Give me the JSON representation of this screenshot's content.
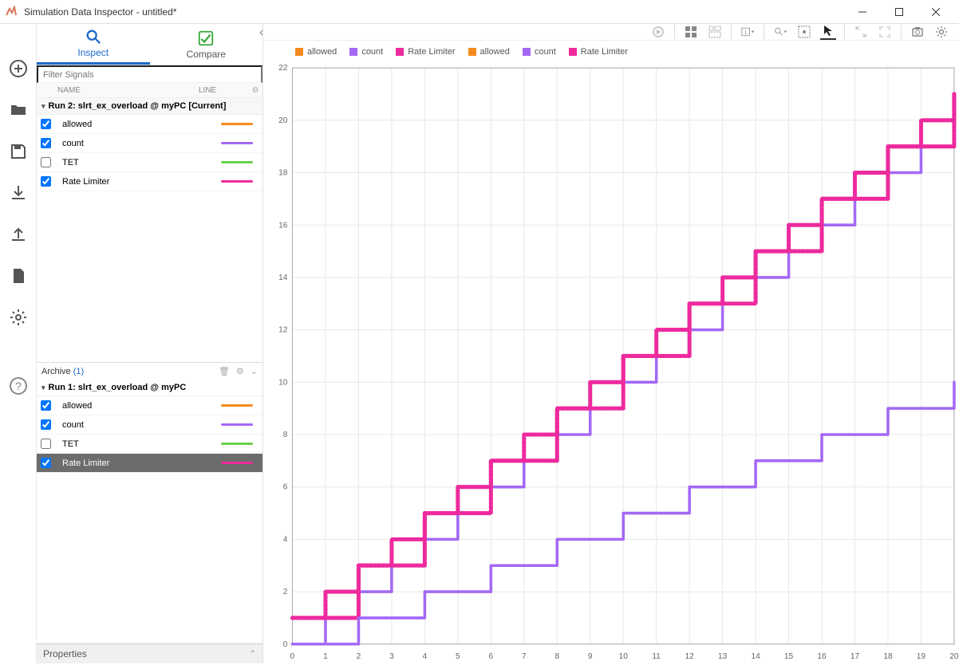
{
  "window": {
    "title": "Simulation Data Inspector - untitled*"
  },
  "tabs": {
    "inspect": "Inspect",
    "compare": "Compare"
  },
  "filter_placeholder": "Filter Signals",
  "columns": {
    "name": "NAME",
    "line": "LINE"
  },
  "run2": {
    "title": "Run 2: slrt_ex_overload @ myPC [Current]",
    "signals": [
      {
        "name": "allowed",
        "checked": true,
        "color": "#f58a1f"
      },
      {
        "name": "count",
        "checked": true,
        "color": "#a468f5"
      },
      {
        "name": "TET",
        "checked": false,
        "color": "#6bd34b"
      },
      {
        "name": "Rate Limiter",
        "checked": true,
        "color": "#ed2a9d"
      }
    ]
  },
  "archive": {
    "label": "Archive",
    "count": "(1)"
  },
  "run1": {
    "title": "Run 1: slrt_ex_overload @ myPC",
    "signals": [
      {
        "name": "allowed",
        "checked": true,
        "color": "#f58a1f"
      },
      {
        "name": "count",
        "checked": true,
        "color": "#a468f5"
      },
      {
        "name": "TET",
        "checked": false,
        "color": "#6bd34b"
      },
      {
        "name": "Rate Limiter",
        "checked": true,
        "color": "#ed2a9d",
        "selected": true
      }
    ]
  },
  "properties_label": "Properties",
  "legend": [
    {
      "label": "allowed",
      "color": "#f58a1f"
    },
    {
      "label": "count",
      "color": "#a468f5"
    },
    {
      "label": "Rate Limiter",
      "color": "#ed2a9d"
    },
    {
      "label": "allowed",
      "color": "#f58a1f"
    },
    {
      "label": "count",
      "color": "#a468f5"
    },
    {
      "label": "Rate Limiter",
      "color": "#ed2a9d"
    }
  ],
  "chart_data": {
    "type": "line",
    "xlim": [
      0,
      20
    ],
    "ylim": [
      0,
      22
    ],
    "xticks": [
      0,
      1,
      2,
      3,
      4,
      5,
      6,
      7,
      8,
      9,
      10,
      11,
      12,
      13,
      14,
      15,
      16,
      17,
      18,
      19,
      20
    ],
    "yticks": [
      0,
      2,
      4,
      6,
      8,
      10,
      12,
      14,
      16,
      18,
      20,
      22
    ],
    "series": [
      {
        "name": "Run2 allowed",
        "color": "#f58a1f",
        "style": "step",
        "x": [
          0,
          1,
          1,
          2,
          2,
          3,
          3,
          4,
          4,
          5,
          5,
          6,
          6,
          7,
          7,
          8,
          8,
          9,
          9,
          10,
          10,
          11,
          11,
          12,
          12,
          13,
          13,
          14,
          14,
          15,
          15,
          16,
          16,
          17,
          17,
          18,
          18,
          19,
          19,
          20,
          20
        ],
        "y": [
          1,
          1,
          2,
          2,
          3,
          3,
          4,
          4,
          5,
          5,
          6,
          6,
          7,
          7,
          8,
          8,
          9,
          9,
          10,
          10,
          11,
          11,
          12,
          12,
          13,
          13,
          14,
          14,
          15,
          15,
          16,
          16,
          17,
          17,
          18,
          18,
          19,
          19,
          20,
          20,
          21
        ]
      },
      {
        "name": "Run2 Rate Limiter",
        "color": "#ed2a9d",
        "style": "step-hash",
        "x": [
          0,
          1,
          1,
          2,
          2,
          3,
          3,
          4,
          4,
          5,
          5,
          6,
          6,
          7,
          7,
          8,
          8,
          9,
          9,
          10,
          10,
          11,
          11,
          12,
          12,
          13,
          13,
          14,
          14,
          15,
          15,
          16,
          16,
          17,
          17,
          18,
          18,
          19,
          19,
          20,
          20
        ],
        "y": [
          1,
          1,
          2,
          2,
          3,
          3,
          4,
          4,
          5,
          5,
          6,
          6,
          7,
          7,
          8,
          8,
          9,
          9,
          10,
          10,
          11,
          11,
          12,
          12,
          13,
          13,
          14,
          14,
          15,
          15,
          16,
          16,
          17,
          17,
          18,
          18,
          19,
          19,
          20,
          20,
          21
        ]
      },
      {
        "name": "Run2 count",
        "color": "#a468f5",
        "style": "step",
        "x": [
          0,
          1,
          1,
          2,
          2,
          3,
          3,
          4,
          4,
          5,
          5,
          6,
          6,
          7,
          7,
          8,
          8,
          9,
          9,
          10,
          10,
          11,
          11,
          12,
          12,
          13,
          13,
          14,
          14,
          15,
          15,
          16,
          16,
          17,
          17,
          18,
          18,
          19,
          19,
          20,
          20
        ],
        "y": [
          0,
          0,
          1,
          1,
          2,
          2,
          3,
          3,
          4,
          4,
          5,
          5,
          6,
          6,
          7,
          7,
          8,
          8,
          9,
          9,
          10,
          10,
          11,
          11,
          12,
          12,
          13,
          13,
          14,
          14,
          15,
          15,
          16,
          16,
          17,
          17,
          18,
          18,
          19,
          19,
          20
        ]
      },
      {
        "name": "Run1 allowed",
        "color": "#f58a1f",
        "style": "step",
        "x": [
          0,
          2,
          2,
          4,
          4,
          6,
          6,
          8,
          8,
          10,
          10,
          12,
          12,
          14,
          14,
          16,
          16,
          18,
          18,
          20,
          20
        ],
        "y": [
          1,
          1,
          3,
          3,
          5,
          5,
          7,
          7,
          9,
          9,
          11,
          11,
          13,
          13,
          15,
          15,
          17,
          17,
          19,
          19,
          21
        ]
      },
      {
        "name": "Run1 Rate Limiter",
        "color": "#ed2a9d",
        "style": "step-hash",
        "x": [
          0,
          2,
          2,
          4,
          4,
          6,
          6,
          8,
          8,
          10,
          10,
          12,
          12,
          14,
          14,
          16,
          16,
          18,
          18,
          20,
          20
        ],
        "y": [
          1,
          1,
          3,
          3,
          5,
          5,
          7,
          7,
          9,
          9,
          11,
          11,
          13,
          13,
          15,
          15,
          17,
          17,
          19,
          19,
          21
        ]
      },
      {
        "name": "Run1 count",
        "color": "#a468f5",
        "style": "step",
        "x": [
          0,
          2,
          2,
          4,
          4,
          6,
          6,
          8,
          8,
          10,
          10,
          12,
          12,
          14,
          14,
          16,
          16,
          18,
          18,
          20,
          20
        ],
        "y": [
          0,
          0,
          1,
          1,
          2,
          2,
          3,
          3,
          4,
          4,
          5,
          5,
          6,
          6,
          7,
          7,
          8,
          8,
          9,
          9,
          10
        ]
      }
    ]
  }
}
